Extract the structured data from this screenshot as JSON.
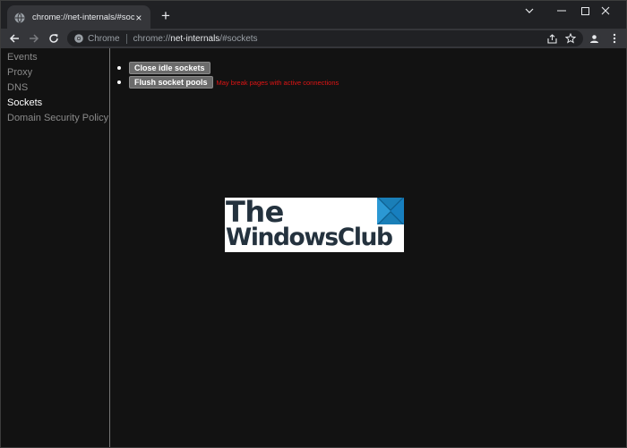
{
  "tab": {
    "title": "chrome://net-internals/#sockets",
    "favicon": "globe-icon",
    "close": "×"
  },
  "new_tab": "+",
  "window_controls": [
    "chevron-down-icon",
    "minimize-icon",
    "maximize-icon",
    "close-icon"
  ],
  "omnibox": {
    "chip": "Chrome",
    "url_scheme": "chrome://",
    "url_host": "net-internals",
    "url_rest": "/#sockets",
    "icons": [
      "share-icon",
      "star-icon"
    ]
  },
  "sidebar": {
    "items": [
      {
        "label": "Events",
        "active": false
      },
      {
        "label": "Proxy",
        "active": false
      },
      {
        "label": "DNS",
        "active": false
      },
      {
        "label": "Sockets",
        "active": true
      },
      {
        "label": "Domain Security Policy",
        "active": false
      }
    ]
  },
  "main": {
    "close_idle_label": "Close idle sockets",
    "flush_pools_label": "Flush socket pools",
    "flush_warning": "May break pages with active connections"
  },
  "watermark": {
    "line1": "The",
    "line2": "WindowsClub"
  },
  "colors": {
    "warning": "#e01414",
    "background": "#121212",
    "chrome_dark": "#202124",
    "toolbar": "#35363a"
  }
}
